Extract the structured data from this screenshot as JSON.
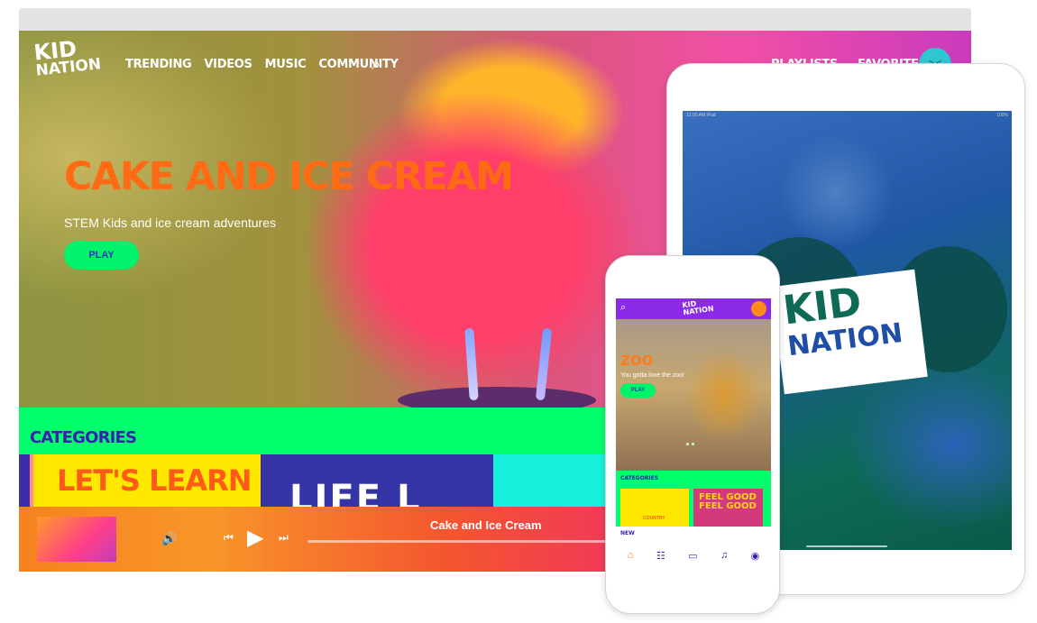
{
  "desktop": {
    "logo": {
      "line1": "KID",
      "line2": "NATION"
    },
    "nav": [
      "TRENDING",
      "VIDEOS",
      "MUSIC",
      "COMMUNITY"
    ],
    "nav_right": [
      "PLAYLISTS",
      "FAVORITES"
    ],
    "hero": {
      "title": "CAKE AND ICE CREAM",
      "subtitle": "STEM Kids and ice cream adventures",
      "play_label": "PLAY"
    },
    "categories_title": "CATEGORIES",
    "category_tiles": [
      "LET'S LEARN",
      "LIFE L"
    ],
    "player": {
      "title": "Cake and Ice Cream"
    }
  },
  "tablet": {
    "status_left": "12:00 AM   iPad",
    "status_right": "100%",
    "logo": {
      "line1": "KID",
      "line2": "NATION"
    }
  },
  "phone": {
    "logo": {
      "line1": "KID",
      "line2": "NATION"
    },
    "hero": {
      "title": "ZOO",
      "subtitle": "You gotta love the zoo!",
      "play_label": "PLAY"
    },
    "categories_title": "CATEGORIES",
    "tiles": [
      "COUNTRY",
      "FEEL GOOD FEEL GOOD"
    ],
    "new_title": "NEW"
  },
  "colors": {
    "accent_orange": "#ff6a14",
    "accent_green": "#00ff6c",
    "accent_purple": "#3b1fb0",
    "phone_header": "#8b2be8"
  },
  "icons": [
    "search-icon",
    "volume-icon",
    "skip-previous-icon",
    "play-icon",
    "skip-next-icon",
    "home-icon",
    "news-icon",
    "tv-icon",
    "music-note-icon",
    "profile-icon"
  ]
}
